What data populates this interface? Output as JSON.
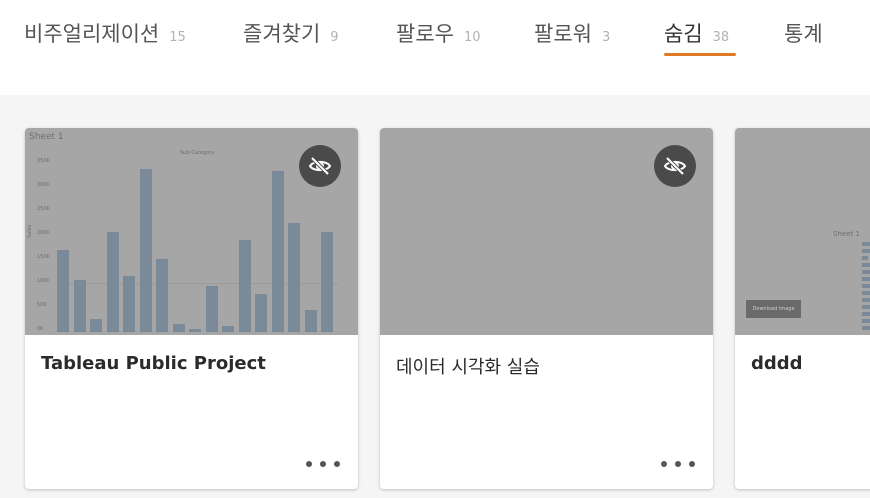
{
  "tabs": [
    {
      "label": "비주얼리제이션",
      "count": "15",
      "active": false
    },
    {
      "label": "즐겨찾기",
      "count": "9",
      "active": false
    },
    {
      "label": "팔로우",
      "count": "10",
      "active": false
    },
    {
      "label": "팔로워",
      "count": "3",
      "active": false
    },
    {
      "label": "숨김",
      "count": "38",
      "active": true
    },
    {
      "label": "통계",
      "count": "",
      "active": false
    }
  ],
  "accent_color": "#e07a27",
  "cards": [
    {
      "title": "Tableau Public Project",
      "thumbnail": {
        "sheet_label": "Sheet 1",
        "chart_title": "Sub-Category",
        "y_axis_label": "Sales",
        "y_ticks": [
          "350K",
          "300K",
          "250K",
          "200K",
          "150K",
          "100K",
          "50K",
          "0K"
        ],
        "chart_data": {
          "type": "bar",
          "values": [
            168,
            108,
            26,
            206,
            115,
            336,
            150,
            17,
            7,
            94,
            12,
            189,
            79,
            331,
            225,
            45,
            206
          ],
          "ylim": [
            0,
            350
          ]
        }
      },
      "hidden_icon": "eye-slash-icon",
      "more_icon": "more-dots-icon"
    },
    {
      "title": "데이터 시각화 실습",
      "hidden_icon": "eye-slash-icon",
      "more_icon": "more-dots-icon"
    },
    {
      "title": "dddd",
      "thumbnail": {
        "sheet_label": "Sheet 1",
        "button_label": "Download Image"
      }
    }
  ]
}
